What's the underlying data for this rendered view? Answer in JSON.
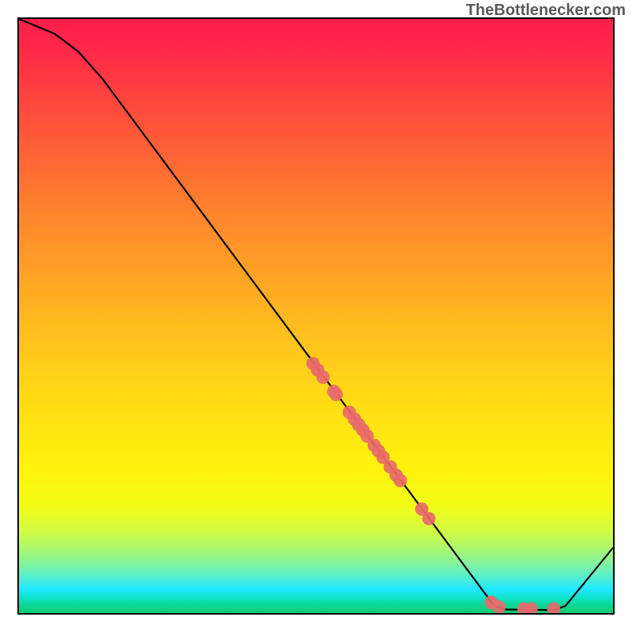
{
  "attribution": "TheBottlenecker.com",
  "chart_data": {
    "type": "line",
    "title": "",
    "xlabel": "",
    "ylabel": "",
    "xlim": [
      0,
      100
    ],
    "ylim": [
      0,
      100
    ],
    "grid": false,
    "legend": false,
    "curve": [
      {
        "x": 0,
        "y": 100
      },
      {
        "x": 6,
        "y": 97.5
      },
      {
        "x": 10,
        "y": 94.5
      },
      {
        "x": 14,
        "y": 90
      },
      {
        "x": 80,
        "y": 1.2
      },
      {
        "x": 82,
        "y": 0.6
      },
      {
        "x": 90,
        "y": 0.5
      },
      {
        "x": 92,
        "y": 1.2
      },
      {
        "x": 100,
        "y": 11
      }
    ],
    "scatter": {
      "color_hex": "#e86a6a",
      "points": [
        {
          "x": 49.5,
          "y": 42.0
        },
        {
          "x": 50.3,
          "y": 40.9
        },
        {
          "x": 51.2,
          "y": 39.7
        },
        {
          "x": 53.0,
          "y": 37.3
        },
        {
          "x": 53.4,
          "y": 36.8
        },
        {
          "x": 55.6,
          "y": 33.8
        },
        {
          "x": 56.5,
          "y": 32.6
        },
        {
          "x": 57.2,
          "y": 31.7
        },
        {
          "x": 57.9,
          "y": 30.8
        },
        {
          "x": 58.6,
          "y": 29.8
        },
        {
          "x": 59.8,
          "y": 28.2
        },
        {
          "x": 60.5,
          "y": 27.3
        },
        {
          "x": 61.3,
          "y": 26.2
        },
        {
          "x": 62.5,
          "y": 24.6
        },
        {
          "x": 63.5,
          "y": 23.2
        },
        {
          "x": 64.2,
          "y": 22.3
        },
        {
          "x": 67.8,
          "y": 17.5
        },
        {
          "x": 69.0,
          "y": 15.9
        },
        {
          "x": 79.5,
          "y": 1.8
        },
        {
          "x": 80.8,
          "y": 1.0
        },
        {
          "x": 85.0,
          "y": 0.7
        },
        {
          "x": 86.2,
          "y": 0.7
        },
        {
          "x": 90.0,
          "y": 0.7
        }
      ]
    }
  }
}
